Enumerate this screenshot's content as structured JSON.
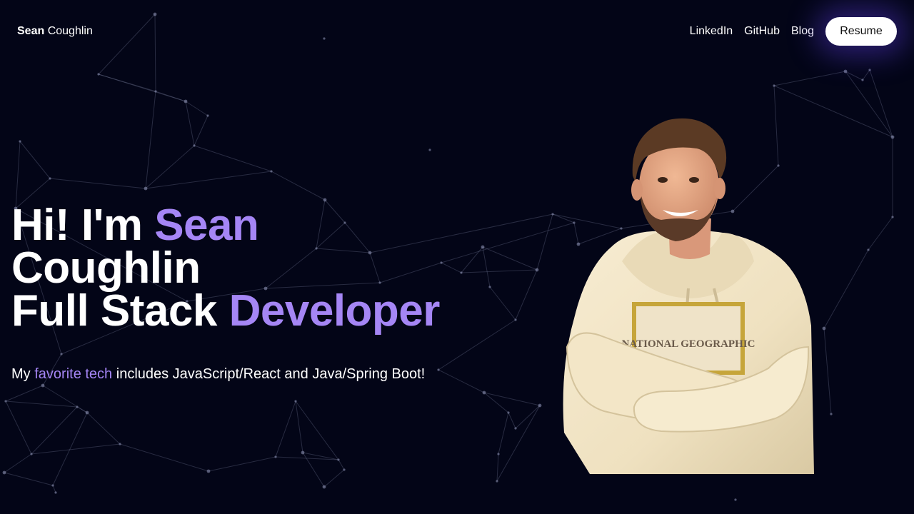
{
  "nav": {
    "brand_first": "Sean",
    "brand_last": "Coughlin",
    "links": [
      "LinkedIn",
      "GitHub",
      "Blog"
    ],
    "resume_label": "Resume"
  },
  "hero": {
    "line1_prefix": "Hi! I'm",
    "line1_accent": "Sean",
    "line2": "Coughlin",
    "line3_prefix": "Full Stack",
    "line3_accent": "Developer",
    "tagline_prefix": "My",
    "tagline_accent": "favorite tech",
    "tagline_suffix": "includes JavaScript/React and Java/Spring Boot!"
  },
  "colors": {
    "background": "#030517",
    "accent": "#a586f5",
    "text": "#ffffff",
    "network_line": "#8a8fb0"
  },
  "portrait": {
    "subject": "smiling man with beard in cream hoodie, arms crossed",
    "hoodie_print": "NATIONAL GEOGRAPHIC"
  }
}
